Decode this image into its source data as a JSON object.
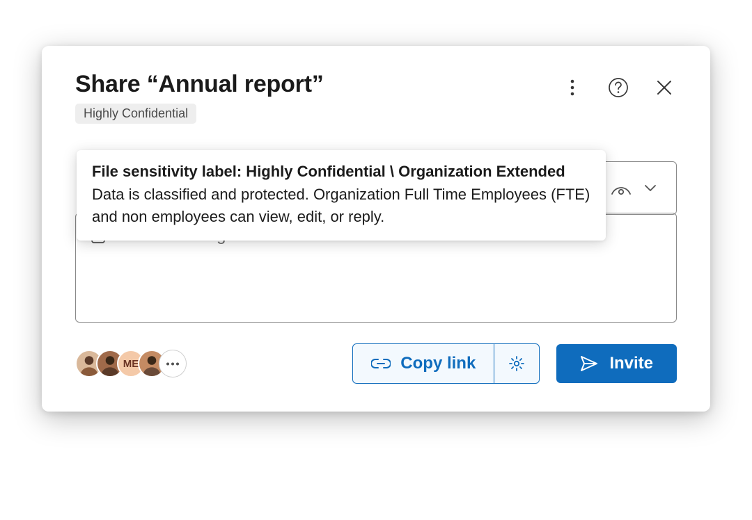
{
  "title": "Share “Annual report”",
  "sensitivity_label": "Highly Confidential",
  "tooltip": {
    "title": "File sensitivity label: Highly Confidential \\ Organization Extended",
    "body": "Data is classified and protected. Organization Full Time Employees (FTE) and non employees can view, edit, or reply."
  },
  "message_placeholder": "Add a message",
  "avatars": [
    {
      "type": "image",
      "bg": "#d9b89a"
    },
    {
      "type": "image",
      "bg": "#a06a4a"
    },
    {
      "type": "initials",
      "text": "ME",
      "bg": "#f4c9a8"
    },
    {
      "type": "image",
      "bg": "#c48b63"
    }
  ],
  "more_indicator": "⋯",
  "copy_link_label": "Copy link",
  "invite_label": "Invite",
  "colors": {
    "primary": "#0f6cbd"
  }
}
